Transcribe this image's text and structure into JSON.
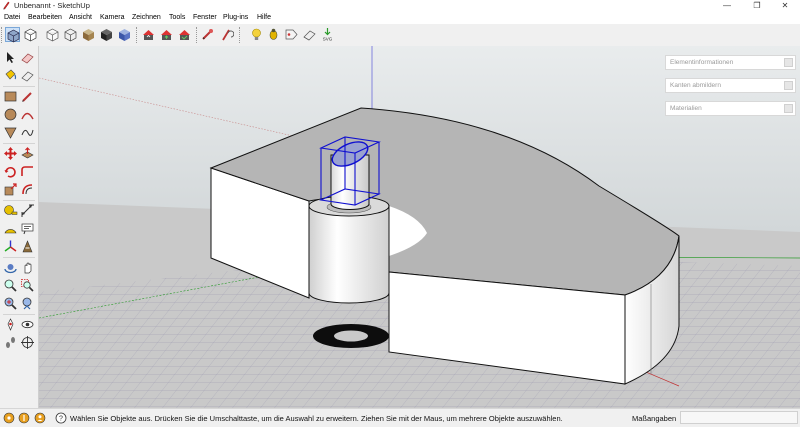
{
  "window": {
    "title": "Unbenannt - SketchUp",
    "minimize_glyph": "—",
    "restore_glyph": "❐",
    "close_glyph": "✕"
  },
  "menu": {
    "items": [
      "Datei",
      "Bearbeiten",
      "Ansicht",
      "Kamera",
      "Zeichnen",
      "Tools",
      "Fenster",
      "Plug-ins",
      "Hilfe"
    ]
  },
  "toolbar": {
    "icons": [
      "iso-view-icon",
      "wireframe-cube-icon",
      "hidden-line-cube-icon",
      "shaded-cube-icon",
      "textured-cube-icon",
      "monochrome-cube-icon",
      "xray-cube-icon",
      "warehouse-icon",
      "share-model-icon",
      "get-models-icon",
      "extension-warehouse-icon",
      "layout-icon",
      "bulb-icon",
      "bug-icon",
      "tag-icon",
      "eraser-icon",
      "svg-export-icon"
    ],
    "svg_label": "SVG"
  },
  "left_tools": {
    "icons": [
      "select-arrow-icon",
      "eraser-tool-icon",
      "paint-bucket-icon",
      "erase-icon",
      "rectangle-icon",
      "pencil-icon",
      "circle-icon",
      "arc-icon",
      "polygon-icon",
      "freehand-icon",
      "move-icon",
      "push-pull-icon",
      "rotate-icon",
      "follow-me-icon",
      "scale-icon",
      "offset-icon",
      "tape-measure-icon",
      "dimension-icon",
      "protractor-icon",
      "text-icon",
      "axes-icon",
      "3d-text-icon",
      "orbit-icon",
      "pan-icon",
      "zoom-icon",
      "zoom-window-icon",
      "zoom-extents-icon",
      "previous-view-icon",
      "position-camera-icon",
      "look-around-icon",
      "walk-icon",
      "section-plane-icon"
    ]
  },
  "trays": {
    "entity_info": "Elementinformationen",
    "soften_edges": "Kanten abmildern",
    "materials": "Materialien"
  },
  "status": {
    "message": "Wählen Sie Objekte aus. Drücken Sie die Umschalttaste, um die Auswahl zu erweitern. Ziehen Sie mit der Maus, um mehrere Objekte auszuwählen.",
    "measurements_label": "Maßangaben",
    "measurements_value": ""
  },
  "colors": {
    "sky": "#cfd6d9",
    "ground": "#c8c8c8",
    "selection": "#1010d0",
    "face_front": "#ffffff",
    "face_top": "#b4b4b4",
    "red_axis": "#c03030",
    "green_axis": "#2a9a2a",
    "blue_axis": "#3030c0"
  }
}
